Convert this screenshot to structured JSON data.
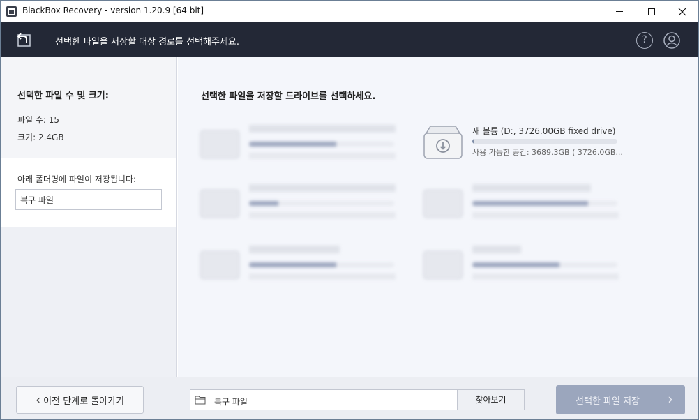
{
  "window": {
    "title": "BlackBox Recovery - version 1.20.9 [64 bit]"
  },
  "header": {
    "instruction": "선택한 파일을 저장할 대상 경로를 선택해주세요.",
    "help_glyph": "?",
    "icons": [
      "back-icon",
      "help-icon",
      "user-icon"
    ]
  },
  "left": {
    "stats_title": "선택한 파일 수 및 크기:",
    "file_count": "파일 수: 15",
    "file_size": "크기: 2.4GB",
    "folder_label": "아래 폴더명에 파일이 저장됩니다:",
    "folder_value": "복구 파일"
  },
  "main": {
    "title": "선택한 파일을 저장할 드라이브를 선택하세요.",
    "selected_drive": {
      "name": "새 볼륨 (D:, 3726.00GB fixed drive)",
      "free_space": "사용 가능한 공간: 3689.3GB ( 3726.0GB...",
      "used_fraction": 0.01
    },
    "blurred_drives": [
      {
        "name": "",
        "used_fraction": 0.6
      },
      {
        "name": "",
        "used_fraction": 0.2
      },
      {
        "name": "",
        "used_fraction": 0.8
      },
      {
        "name": "",
        "used_fraction": 0.6
      },
      {
        "name": "",
        "used_fraction": 0.6
      }
    ]
  },
  "footer": {
    "back_label": "이전 단계로 돌아가기",
    "path_value": "복구 파일",
    "browse_label": "찾아보기",
    "save_label": "선택한 파일 저장",
    "colors": {
      "save_button_disabled": "#9ba6bd",
      "header_bg": "#232836"
    }
  }
}
